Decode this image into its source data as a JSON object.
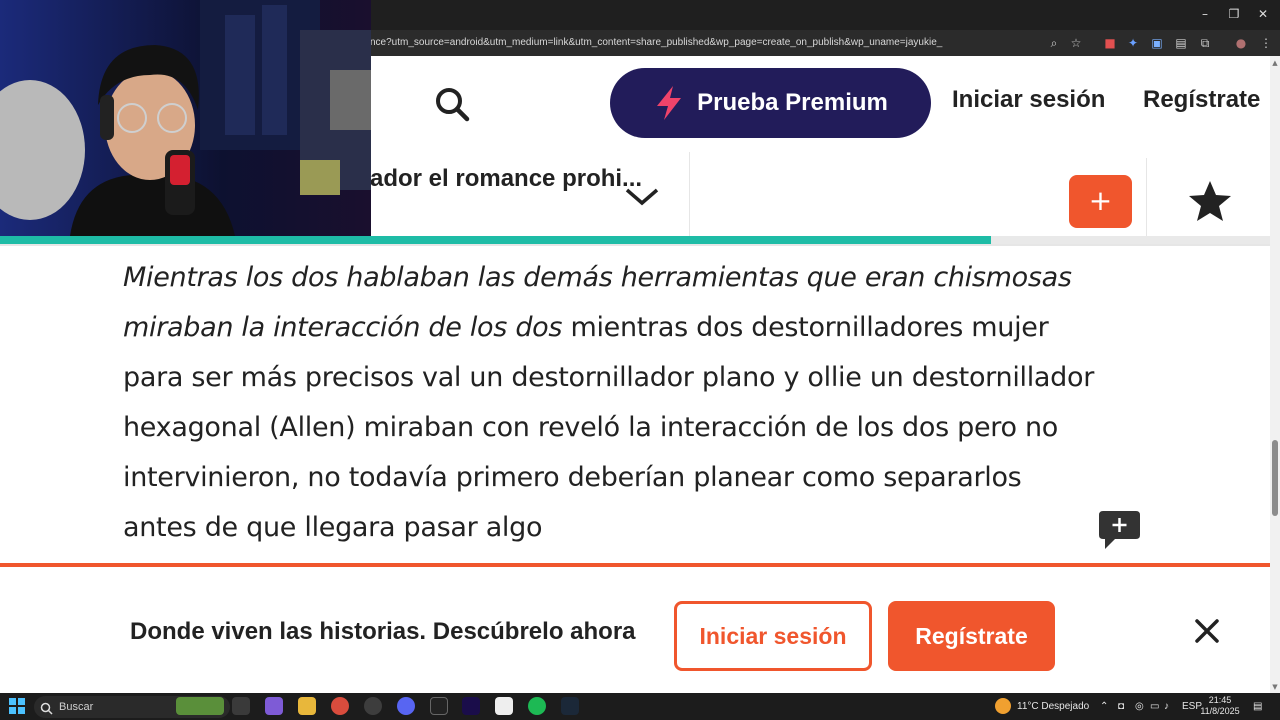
{
  "browser": {
    "url": "nce?utm_source=android&utm_medium=link&utm_content=share_published&wp_page=create_on_publish&wp_uname=jayukie_",
    "window_controls": [
      "–",
      "❐",
      "✕"
    ]
  },
  "header": {
    "premium_label": "Prueba Premium",
    "login_label": "Iniciar sesión",
    "signup_label": "Regístrate"
  },
  "story": {
    "title": "ador el romance prohi...",
    "reading_progress_percent": 78
  },
  "content": {
    "italic_part": "Mientras los dos hablaban las demás herramientas que eran chismosas miraban la interacción de los dos",
    "rest_part": " mientras dos destornilladores mujer para ser más precisos val un destornillador plano y ollie un destornillador hexagonal (Allen) miraban con reveló la interacción de los dos pero no intervinieron, no todavía primero deberían planear como separarlos antes de que llegara pasar algo"
  },
  "banner": {
    "text": "Donde viven las historias. Descúbrelo ahora",
    "login_label": "Iniciar sesión",
    "signup_label": "Regístrate"
  },
  "taskbar": {
    "search_label": "Buscar",
    "weather": "11°C  Despejado",
    "language": "ESP",
    "time": "21:45",
    "date": "11/8/2025"
  },
  "colors": {
    "accent_orange": "#f0562d",
    "premium_bg": "#221c5a",
    "progress_teal": "#1ebca6"
  }
}
